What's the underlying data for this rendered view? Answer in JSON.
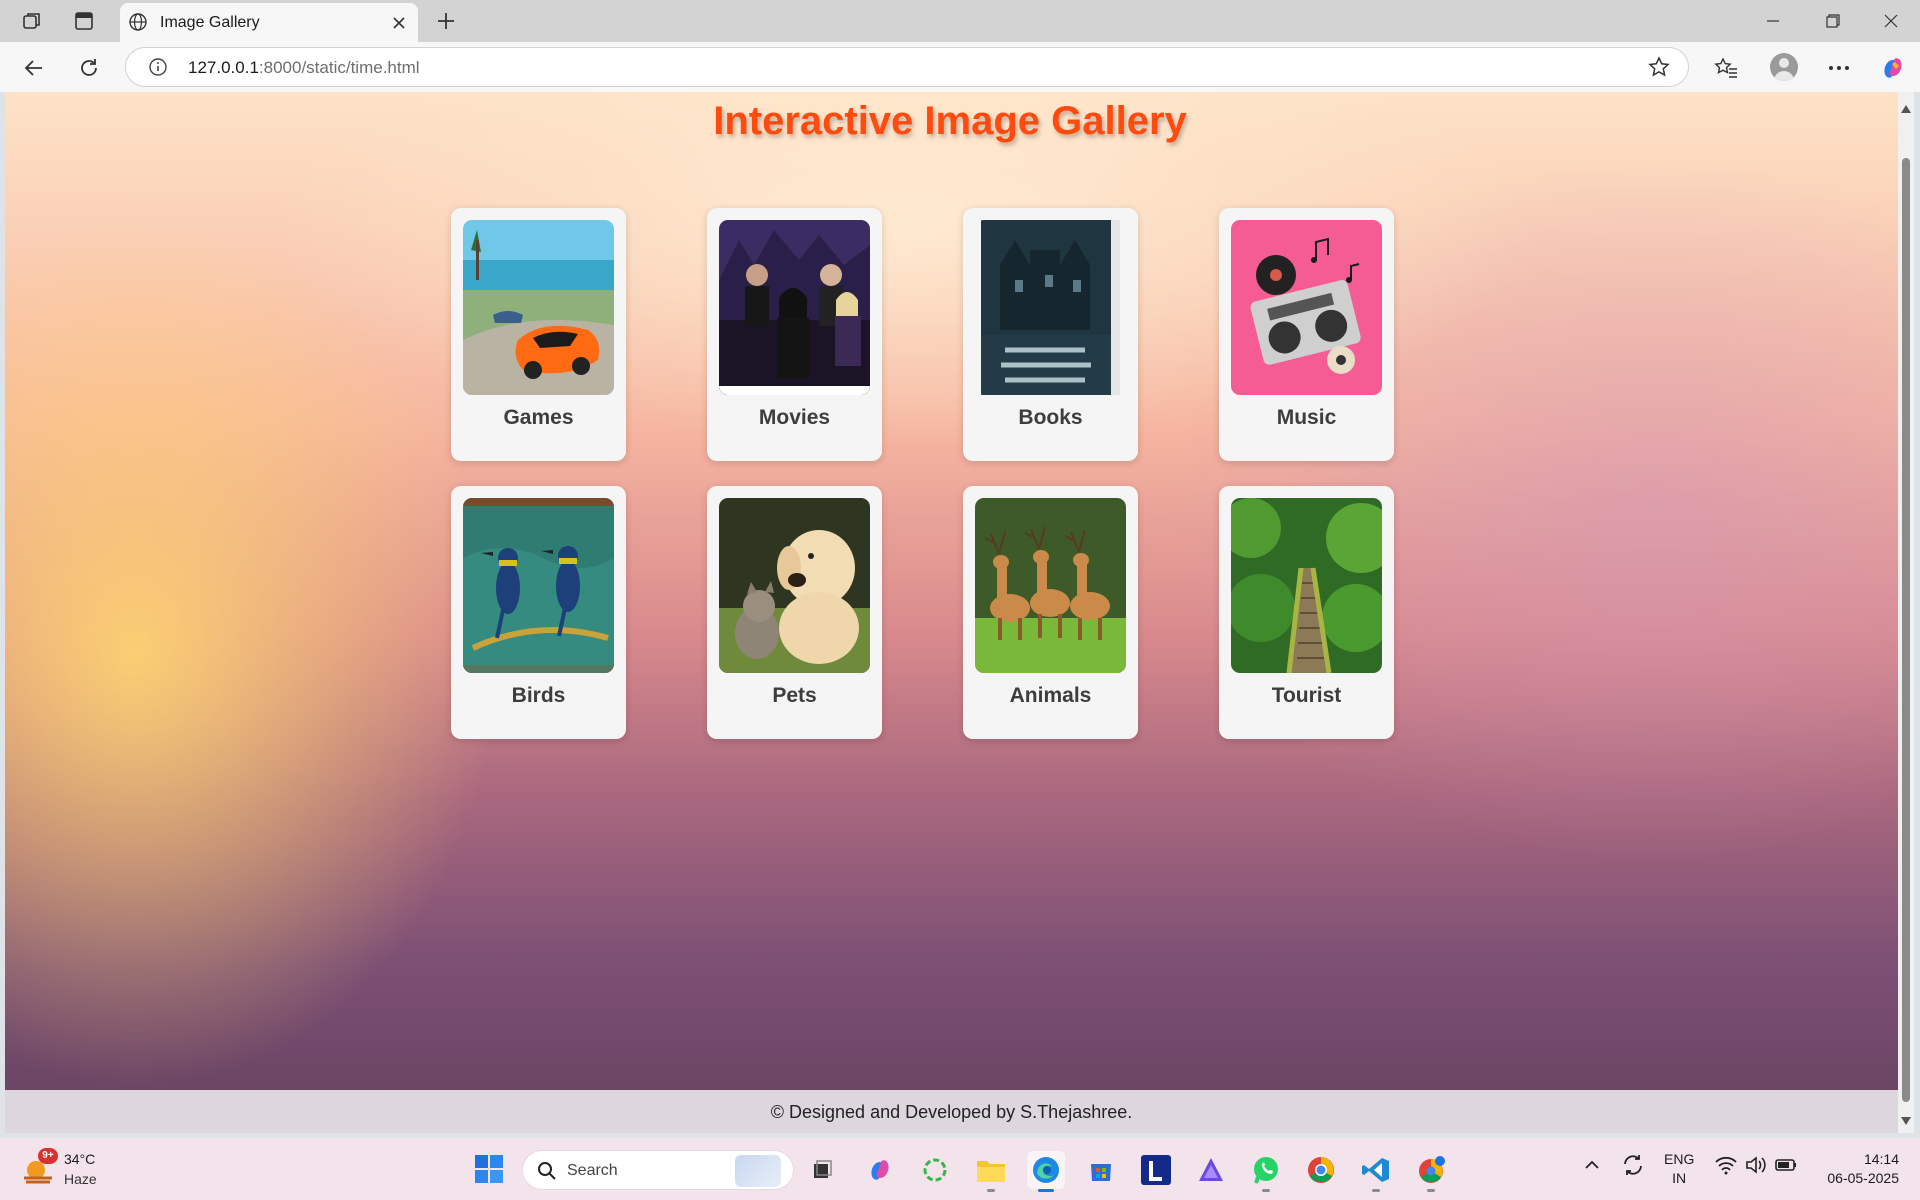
{
  "browser": {
    "tab_title": "Image Gallery",
    "url_host": "127.0.0.1",
    "url_rest": ":8000/static/time.html"
  },
  "page": {
    "title": "Interactive Image Gallery",
    "cards": [
      {
        "label": "Games"
      },
      {
        "label": "Movies"
      },
      {
        "label": "Books"
      },
      {
        "label": "Music"
      },
      {
        "label": "Birds"
      },
      {
        "label": "Pets"
      },
      {
        "label": "Animals"
      },
      {
        "label": "Tourist"
      }
    ],
    "footer": "© Designed and Developed by S.Thejashree."
  },
  "taskbar": {
    "weather_temp": "34°C",
    "weather_cond": "Haze",
    "notification_badge": "9+",
    "search_placeholder": "Search",
    "lang_top": "ENG",
    "lang_bottom": "IN",
    "time": "14:14",
    "date": "06-05-2025"
  },
  "colors": {
    "title": "#ff4b0d",
    "card_bg": "#f6f5f5",
    "accent_edge": "#1a73e8"
  }
}
